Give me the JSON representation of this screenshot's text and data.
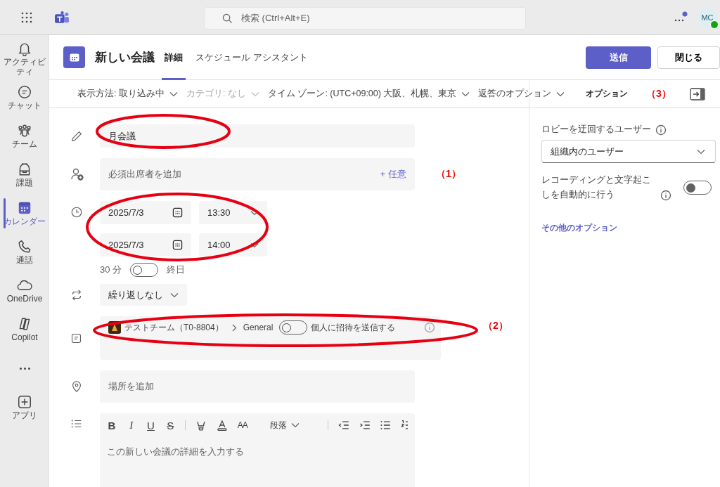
{
  "top_bar": {
    "search": {
      "placeholder": "検索 (Ctrl+Alt+E)"
    },
    "avatar": "MC"
  },
  "sidebar": {
    "items": [
      {
        "kind": "activity",
        "label": "アクティビティ",
        "selected": false
      },
      {
        "kind": "chat",
        "label": "チャット",
        "selected": false
      },
      {
        "kind": "teams",
        "label": "チーム",
        "selected": false
      },
      {
        "kind": "assignments",
        "label": "課題",
        "selected": false
      },
      {
        "kind": "calendar",
        "label": "カレンダー",
        "selected": true
      },
      {
        "kind": "calls",
        "label": "通話",
        "selected": false
      },
      {
        "kind": "onedrive",
        "label": "OneDrive",
        "selected": false
      },
      {
        "kind": "copilot",
        "label": "Copilot",
        "selected": false
      },
      {
        "kind": "more"
      },
      {
        "kind": "apps",
        "label": "アプリ",
        "selected": false
      }
    ]
  },
  "header": {
    "title": "新しい会議",
    "tabs": [
      {
        "label": "詳細",
        "selected": true
      },
      {
        "label": "スケジュール アシスタント",
        "selected": false
      }
    ],
    "buttons": [
      {
        "label": "送信",
        "kind": "primary"
      },
      {
        "label": "閉じる",
        "kind": "secondary"
      }
    ]
  },
  "toolbar": {
    "dropdowns": [
      {
        "label": "表示方法: 取り込み中",
        "disabled": false
      },
      {
        "label": "カテゴリ: なし",
        "disabled": true
      },
      {
        "label": "タイム ゾーン: (UTC+09:00) 大阪、札幌、東京",
        "disabled": false
      },
      {
        "label": "返答のオプション",
        "disabled": false
      }
    ]
  },
  "form": {
    "title": {
      "value": "月会議"
    },
    "attendees": {
      "placeholder": "必須出席者を追加",
      "optional": "+ 任意",
      "annotation": "（1）"
    },
    "start": {
      "date": "2025/7/3",
      "time": "13:30"
    },
    "end": {
      "date": "2025/7/3",
      "time": "14:00"
    },
    "duration": "30 分",
    "all_day": {
      "label": "終日",
      "on": false
    },
    "repeat": "繰り返しなし",
    "channel": {
      "team": "テストチーム（T0-8804）",
      "channel": "General",
      "invite": {
        "label": "個人に招待を送信する",
        "on": false
      },
      "annotation": "（2）"
    },
    "location": {
      "placeholder": "場所を追加"
    },
    "editor": {
      "format_buttons": [
        "B",
        "I",
        "U",
        "S"
      ],
      "font_size": "AA",
      "paragraph": "段落",
      "placeholder": "この新しい会議の詳細を入力する"
    }
  },
  "options": {
    "title": "オプション",
    "annotation": "（3）",
    "lobby": {
      "label": "ロビーを迂回するユーザー",
      "value": "組織内のユーザー"
    },
    "recording": {
      "label": "レコーディングと文字起こしを自動的に行う",
      "on": false
    },
    "more_link": "その他のオプション"
  }
}
